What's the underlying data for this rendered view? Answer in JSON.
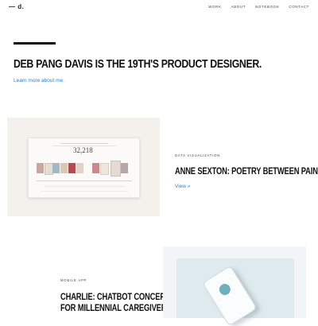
{
  "header": {
    "logo": "— d.",
    "nav": [
      "WORK",
      "ABOUT",
      "NOTEBOOK",
      "CONTACT"
    ]
  },
  "hero": {
    "headline": "DEB PANG DAVIS IS THE 19TH'S PRODUCT DESIGNER.",
    "link": "Learn more about me."
  },
  "projects": [
    {
      "tag": "DATA VISUALIZATION",
      "title": "ANNE SEXTON: POETRY BETWEEN PAIN",
      "link": "View »",
      "thumbnail_number": "32,218"
    },
    {
      "tag": "MOBILE APP",
      "title_line1": "CHARLIE: CHATBOT CONCEPT",
      "title_line2": "FOR MILLENNIAL CAREGIVERS"
    }
  ],
  "colors": {
    "accent_link": "#2f7fc8",
    "text": "#111111",
    "thumb1_bg": "#f4f1ed",
    "thumb2_bg": "#dfeaee"
  }
}
